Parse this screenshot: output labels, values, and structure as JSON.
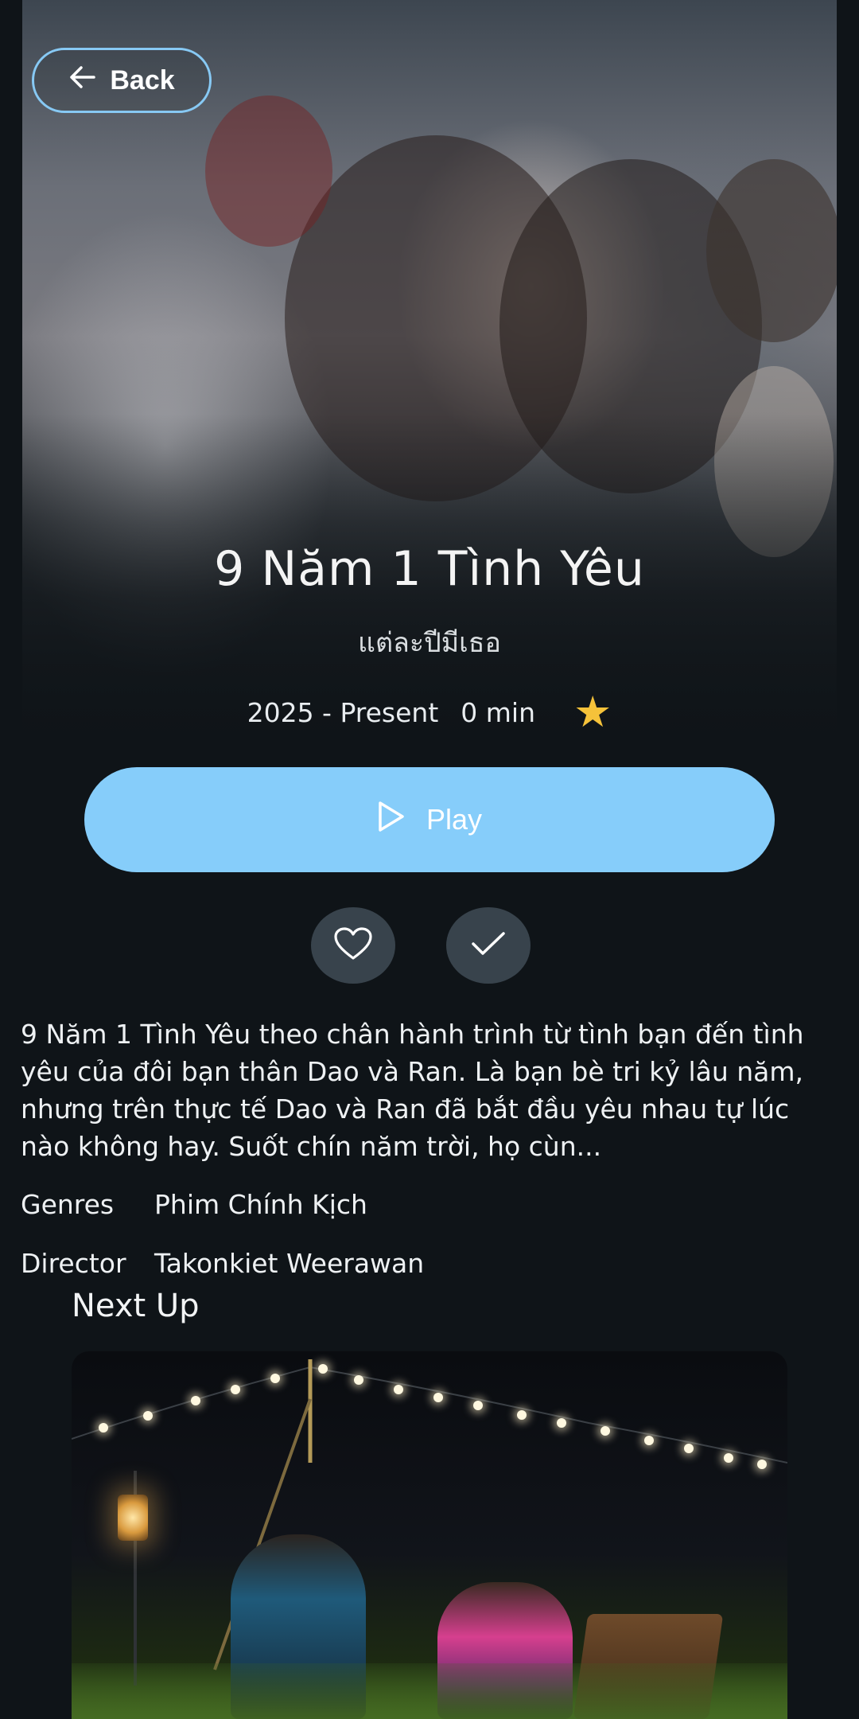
{
  "header": {
    "back_label": "Back"
  },
  "show": {
    "title": "9 Năm 1 Tình Yêu",
    "original_title": "แต่ละปีมีเธอ",
    "years": "2025 - Present",
    "duration": "0 min",
    "rating_icon": "star-icon"
  },
  "actions": {
    "play_label": "Play",
    "favorite_icon": "heart-icon",
    "watched_icon": "check-icon"
  },
  "description": "9 Năm 1 Tình Yêu theo chân hành trình từ tình bạn đến tình yêu của đôi bạn thân Dao và Ran. Là bạn bè tri kỷ lâu năm, nhưng trên thực tế Dao và Ran đã bắt đầu yêu nhau tự lúc nào không hay. Suốt chín năm trời, họ cùn...",
  "details": {
    "genres_label": "Genres",
    "genres_value": "Phim Chính Kịch",
    "director_label": "Director",
    "director_value": "Takonkiet Weerawan"
  },
  "next_up": {
    "heading": "Next Up"
  },
  "colors": {
    "background": "#0f1418",
    "accent": "#86cdfa",
    "star": "#f5c23a",
    "circle_button": "#38434c"
  }
}
